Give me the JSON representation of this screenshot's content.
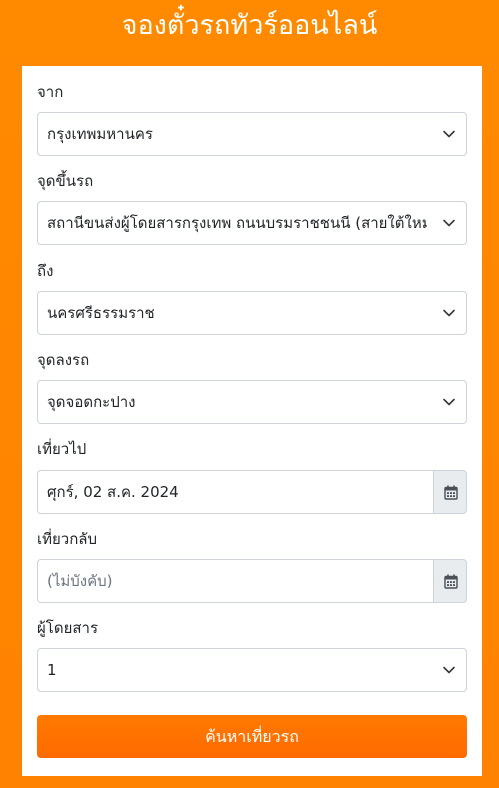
{
  "header": {
    "title": "จองตั๋วรถทัวร์ออนไลน์"
  },
  "form": {
    "from": {
      "label": "จาก",
      "value": "กรุงเทพมหานคร"
    },
    "pickup": {
      "label": "จุดขึ้นรถ",
      "value": "สถานีขนส่งผู้โดยสารกรุงเทพ ถนนบรมราชชนนี (สายใต้ใหม่)"
    },
    "to": {
      "label": "ถึง",
      "value": "นครศรีธรรมราช"
    },
    "dropoff": {
      "label": "จุดลงรถ",
      "value": "จุดจอดกะปาง"
    },
    "depart": {
      "label": "เที่ยวไป",
      "value": "ศุกร์, 02 ส.ค. 2024"
    },
    "return": {
      "label": "เที่ยวกลับ",
      "placeholder": "(ไม่บังคับ)"
    },
    "passengers": {
      "label": "ผู้โดยสาร",
      "value": "1"
    },
    "search_label": "ค้นหาเที่ยวรถ"
  },
  "icons": {
    "select_arrow": "chevron-down-icon",
    "calendar": "calendar-icon"
  },
  "colors": {
    "background": "#ff8a00",
    "button": "#ff6a00"
  }
}
